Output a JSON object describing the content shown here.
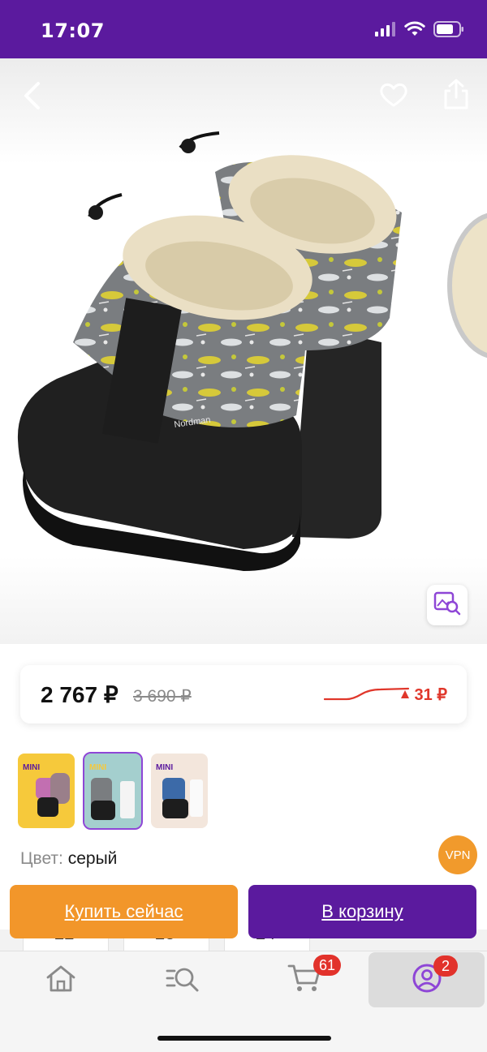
{
  "status_bar": {
    "time": "17:07",
    "background": "#5b1a9e",
    "icons": [
      "signal-icon",
      "wifi-icon",
      "battery-icon"
    ]
  },
  "hero": {
    "icons": [
      "back-arrow-icon",
      "heart-icon",
      "share-icon",
      "image-search-icon"
    ]
  },
  "price": {
    "current": "2 767 ₽",
    "old": "3 690 ₽",
    "change": "31 ₽",
    "change_color": "#e0372b"
  },
  "thumbnails": {
    "items": [
      {
        "label": "MINI",
        "selected": false
      },
      {
        "label": "MINI",
        "selected": true
      },
      {
        "label": "MINI",
        "selected": false
      }
    ],
    "selected_index": 1
  },
  "color": {
    "label": "Цвет:",
    "value": "серый"
  },
  "vpn_badge": "VPN",
  "behind_sizes": [
    "22",
    "23",
    "24"
  ],
  "actions": {
    "buy_now": "Купить сейчас",
    "add_to_cart": "В корзину",
    "buy_color": "#f2962a",
    "cart_color": "#5b1a9e"
  },
  "tab_bar": {
    "tabs": [
      {
        "icon": "home-icon"
      },
      {
        "icon": "catalog-search-icon"
      },
      {
        "icon": "cart-icon",
        "badge": "61"
      },
      {
        "icon": "profile-icon",
        "badge": "2",
        "active": true
      }
    ]
  }
}
